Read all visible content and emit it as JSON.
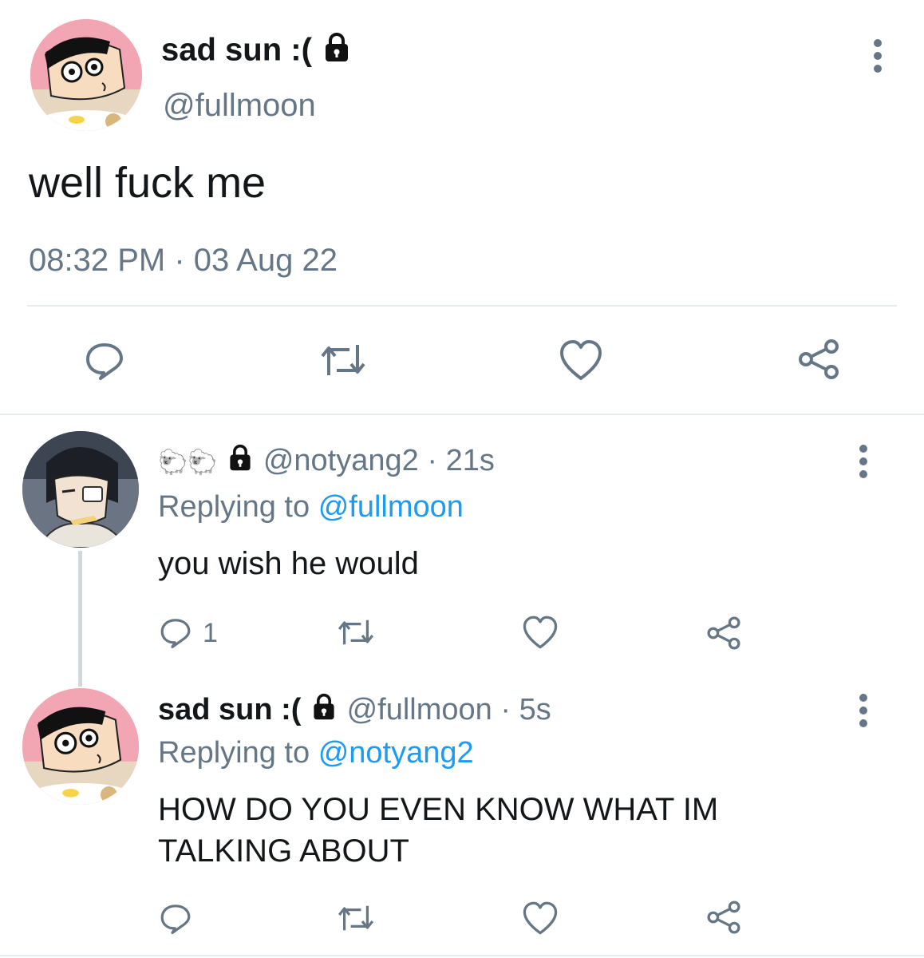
{
  "main_tweet": {
    "display_name": "sad sun :(",
    "handle": "@fullmoon",
    "text": "well fuck me",
    "timestamp": "08:32 PM · 03 Aug 22",
    "icons": {
      "avatar": "avatar-image",
      "locked": "lock-icon",
      "more": "more-vertical-icon",
      "reply": "reply-icon",
      "retweet": "retweet-icon",
      "like": "heart-icon",
      "share": "share-icon"
    }
  },
  "replies": [
    {
      "display_name_emoji": "🐑🐑",
      "handle": "@notyang2",
      "time": "21s",
      "replying_label": "Replying to",
      "replying_to": "@fullmoon",
      "text": "you wish he would",
      "reply_count": "1"
    },
    {
      "display_name": "sad sun :(",
      "handle": "@fullmoon",
      "time": "5s",
      "replying_label": "Replying to",
      "replying_to": "@notyang2",
      "text_line1": "HOW DO YOU EVEN KNOW WHAT IM",
      "text_line2": "TALKING ABOUT"
    }
  ],
  "separator": "·",
  "colors": {
    "text": "#14171a",
    "muted": "#657786",
    "link": "#1d9bf0",
    "divider": "#e6ecf0",
    "icon": "#657786"
  }
}
